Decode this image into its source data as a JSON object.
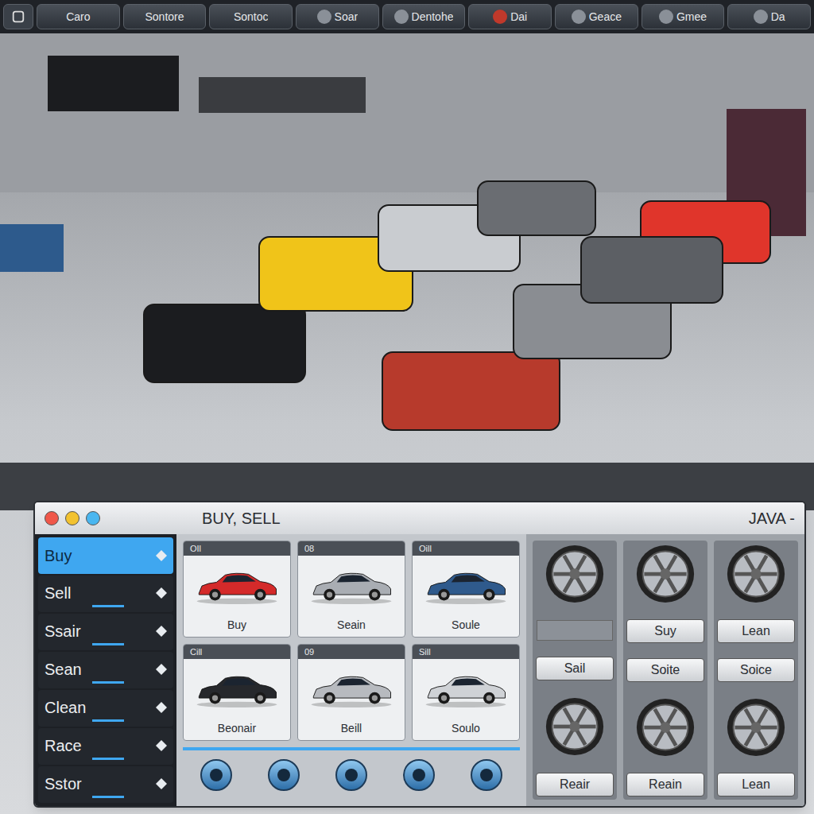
{
  "top_bar": {
    "tabs": [
      {
        "label": "Caro",
        "selected": false
      },
      {
        "label": "Sontore",
        "selected": false
      },
      {
        "label": "Sontoc",
        "selected": false
      },
      {
        "label": "Soar",
        "selected": false
      },
      {
        "label": "Dentohe",
        "selected": false
      },
      {
        "label": "Dai",
        "selected": false
      },
      {
        "label": "Geace",
        "selected": false
      },
      {
        "label": "Gmee",
        "selected": false
      },
      {
        "label": "Da",
        "selected": false
      }
    ]
  },
  "panel": {
    "title": "BUY, SELL",
    "brand": "JAVA -",
    "dots": [
      {
        "color": "#f0574a"
      },
      {
        "color": "#f2c230"
      },
      {
        "color": "#49b6f0"
      }
    ]
  },
  "sidebar": {
    "items": [
      {
        "label": "Buy",
        "selected": true
      },
      {
        "label": "Sell",
        "selected": false
      },
      {
        "label": "Ssair",
        "selected": false
      },
      {
        "label": "Sean",
        "selected": false
      },
      {
        "label": "Clean",
        "selected": false
      },
      {
        "label": "Race",
        "selected": false
      },
      {
        "label": "Sstor",
        "selected": false
      }
    ]
  },
  "cards": [
    {
      "tag": "OIl",
      "label": "Buy",
      "color": "#d42a2a"
    },
    {
      "tag": "08",
      "label": "Seain",
      "color": "#a9adb3"
    },
    {
      "tag": "Oill",
      "label": "Soule",
      "color": "#2f5a8c"
    },
    {
      "tag": "Cill",
      "label": "Beonair",
      "color": "#26282c"
    },
    {
      "tag": "09",
      "label": "Beill",
      "color": "#b7babf"
    },
    {
      "tag": "Sill",
      "label": "Soulo",
      "color": "#cfd2d6"
    }
  ],
  "wheel_columns": [
    {
      "items": [
        {
          "kind": "wheel",
          "label": ""
        },
        {
          "kind": "blank",
          "label": ""
        },
        {
          "kind": "button",
          "label": "Sail"
        },
        {
          "kind": "wheel",
          "label": ""
        },
        {
          "kind": "button",
          "label": "Reair"
        }
      ]
    },
    {
      "items": [
        {
          "kind": "wheel",
          "label": ""
        },
        {
          "kind": "button",
          "label": "Suy"
        },
        {
          "kind": "button",
          "label": "Soite"
        },
        {
          "kind": "wheel",
          "label": ""
        },
        {
          "kind": "button",
          "label": "Reain"
        }
      ]
    },
    {
      "items": [
        {
          "kind": "wheel",
          "label": ""
        },
        {
          "kind": "button",
          "label": "Lean"
        },
        {
          "kind": "button",
          "label": "Soice"
        },
        {
          "kind": "wheel",
          "label": ""
        },
        {
          "kind": "button",
          "label": "Lean"
        }
      ]
    }
  ]
}
